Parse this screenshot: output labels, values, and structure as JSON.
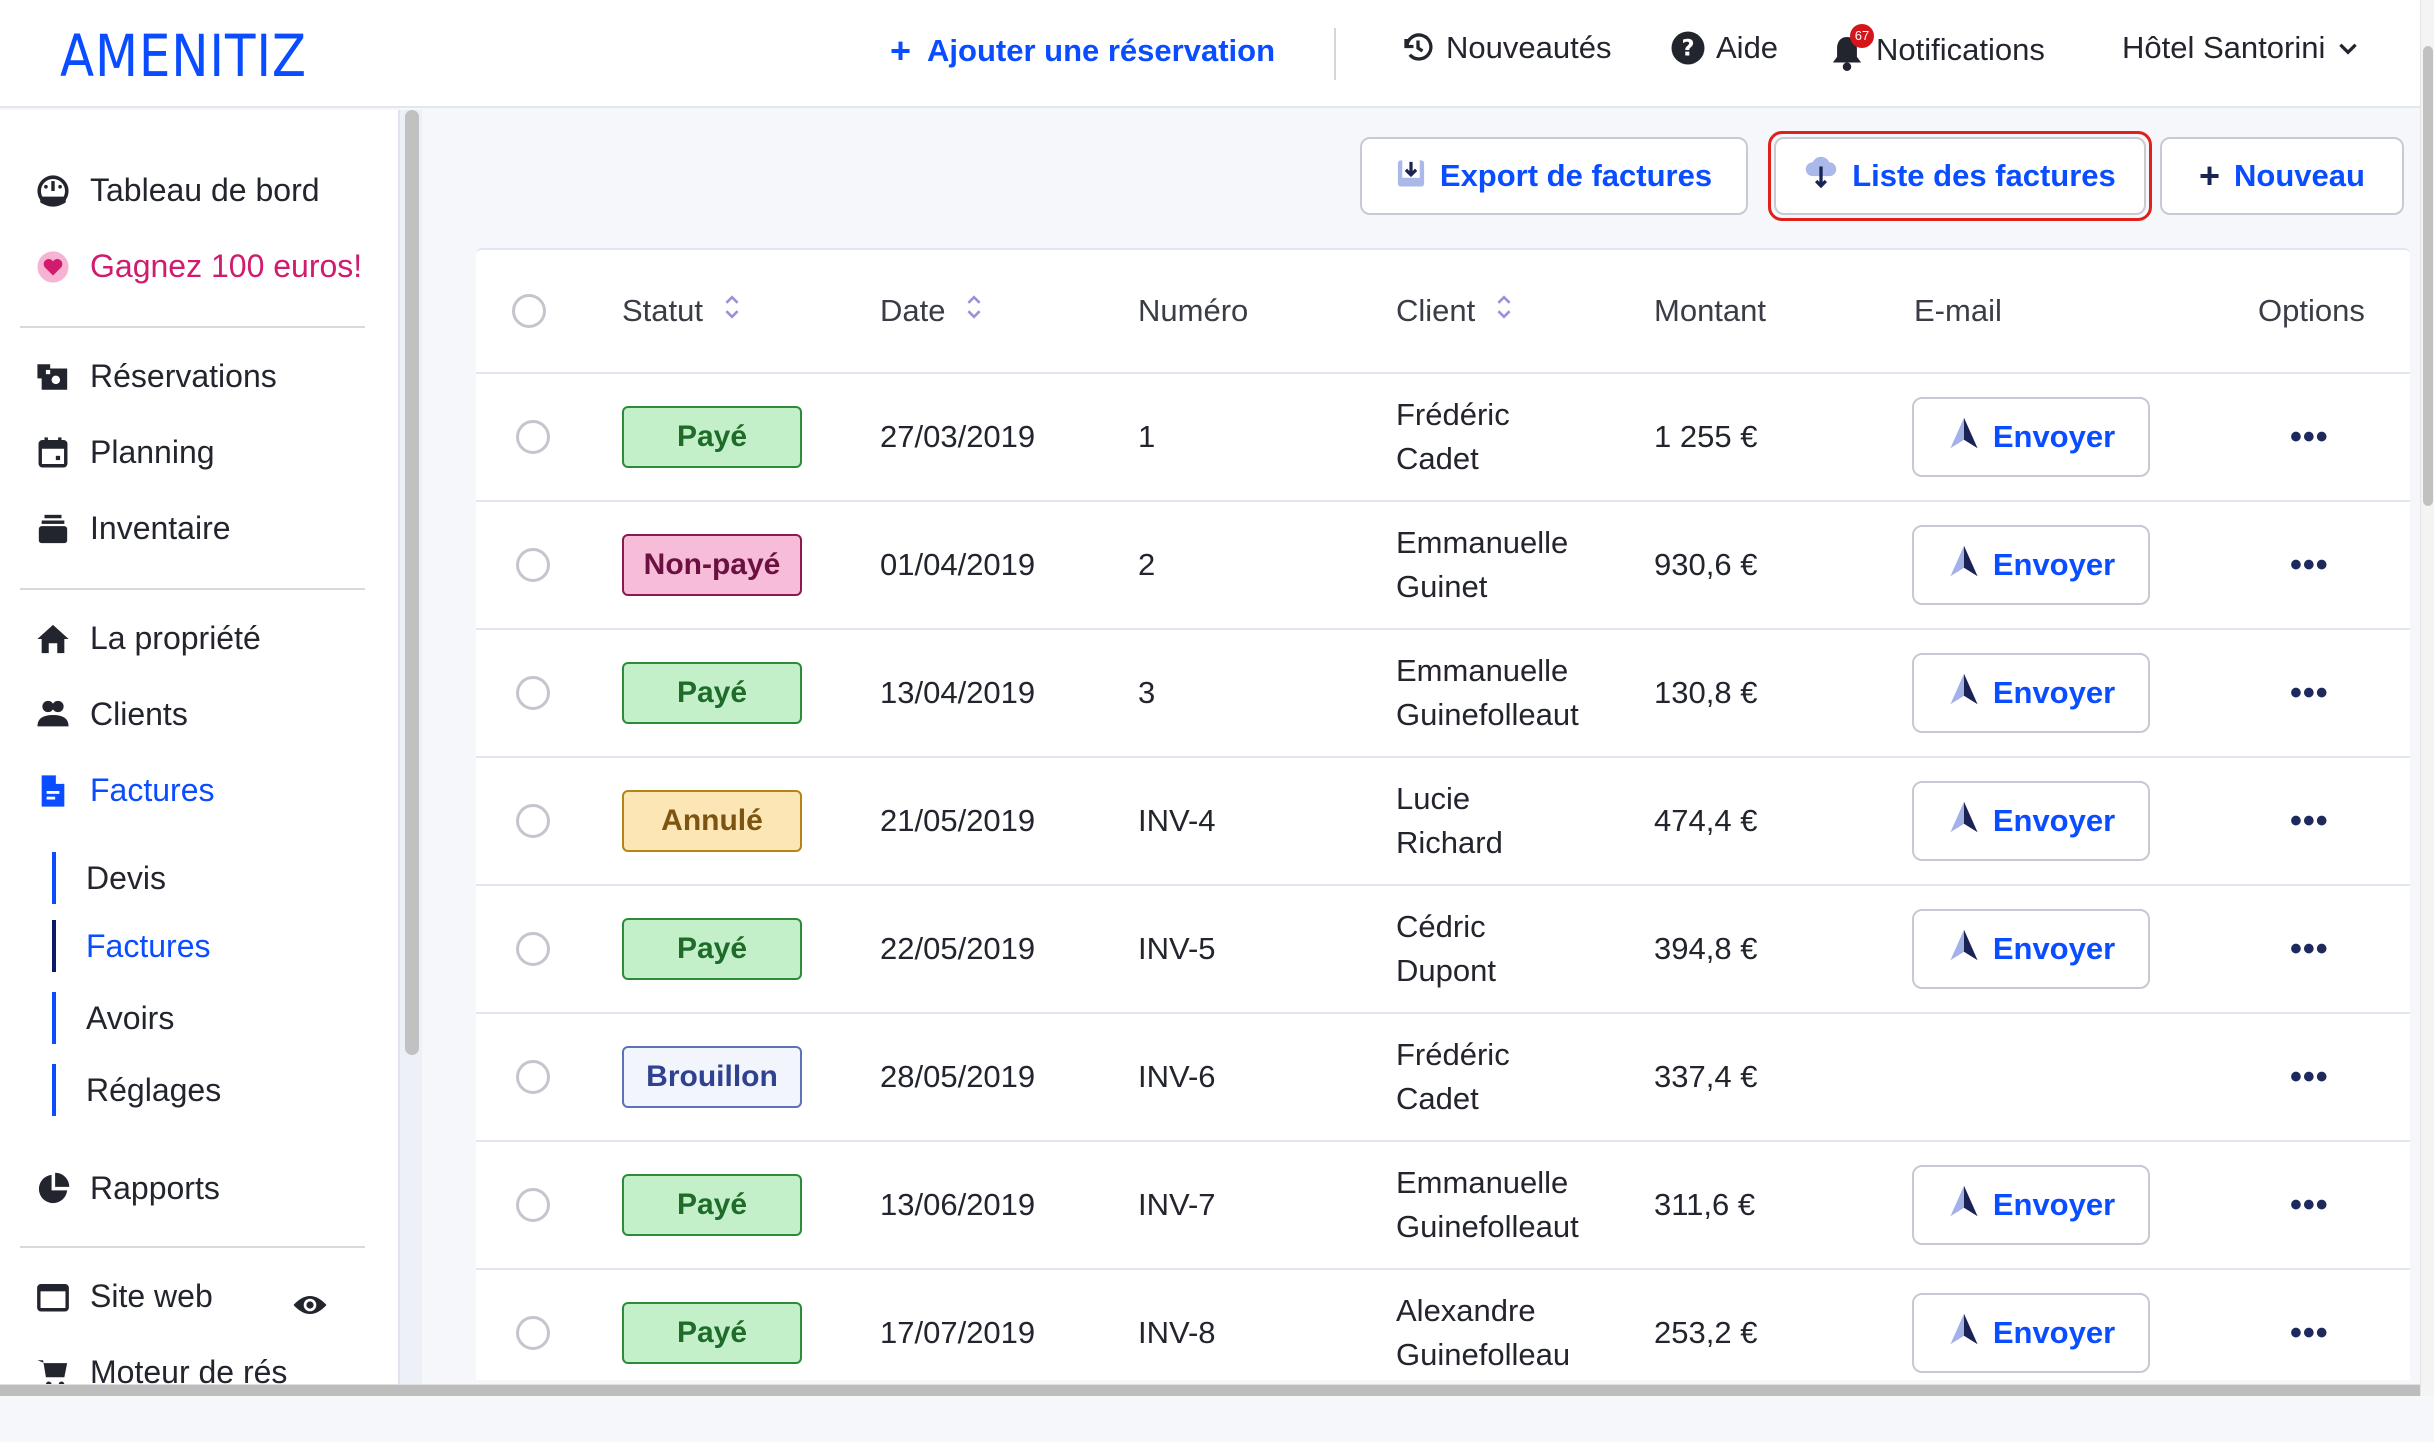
{
  "brand": {
    "logo_text": "AMENITIZ",
    "accent_color": "#0a4cff"
  },
  "header": {
    "add_reservation_label": "Ajouter une réservation",
    "news_label": "Nouveautés",
    "help_label": "Aide",
    "notifications_label": "Notifications",
    "notifications_count": "67",
    "hotel_name": "Hôtel Santorini"
  },
  "sidebar": {
    "items": [
      {
        "label": "Tableau de bord",
        "icon": "dashboard-icon"
      },
      {
        "label": "Gagnez 100 euros!",
        "icon": "heart-icon"
      },
      {
        "label": "Réservations",
        "icon": "reservations-icon"
      },
      {
        "label": "Planning",
        "icon": "calendar-icon"
      },
      {
        "label": "Inventaire",
        "icon": "inventory-icon"
      },
      {
        "label": "La propriété",
        "icon": "home-icon"
      },
      {
        "label": "Clients",
        "icon": "users-icon"
      },
      {
        "label": "Factures",
        "icon": "invoice-icon",
        "active": true
      },
      {
        "label": "Rapports",
        "icon": "pie-chart-icon"
      },
      {
        "label": "Site web",
        "icon": "browser-window-icon"
      },
      {
        "label": "Moteur de rés",
        "icon": "cart-icon"
      }
    ],
    "sub_items": [
      {
        "label": "Devis"
      },
      {
        "label": "Factures",
        "active": true
      },
      {
        "label": "Avoirs"
      },
      {
        "label": "Réglages"
      }
    ]
  },
  "toolbar": {
    "export_label": "Export de factures",
    "list_label": "Liste des factures",
    "new_label": "Nouveau"
  },
  "table": {
    "columns": [
      "Statut",
      "Date",
      "Numéro",
      "Client",
      "Montant",
      "E-mail",
      "Options"
    ],
    "send_label": "Envoyer",
    "options_label": "•••",
    "rows": [
      {
        "status": "Payé",
        "status_kind": "paid",
        "date": "27/03/2019",
        "number": "1",
        "client_first": "Frédéric",
        "client_last": "Cadet",
        "amount": "1 255 €",
        "can_send": true
      },
      {
        "status": "Non-payé",
        "status_kind": "unpaid",
        "date": "01/04/2019",
        "number": "2",
        "client_first": "Emmanuelle",
        "client_last": "Guinet",
        "amount": "930,6 €",
        "can_send": true
      },
      {
        "status": "Payé",
        "status_kind": "paid",
        "date": "13/04/2019",
        "number": "3",
        "client_first": "Emmanuelle",
        "client_last": "Guinefolleaut",
        "amount": "130,8 €",
        "can_send": true
      },
      {
        "status": "Annulé",
        "status_kind": "cancelled",
        "date": "21/05/2019",
        "number": "INV-4",
        "client_first": "Lucie",
        "client_last": "Richard",
        "amount": "474,4 €",
        "can_send": true
      },
      {
        "status": "Payé",
        "status_kind": "paid",
        "date": "22/05/2019",
        "number": "INV-5",
        "client_first": "Cédric",
        "client_last": "Dupont",
        "amount": "394,8 €",
        "can_send": true
      },
      {
        "status": "Brouillon",
        "status_kind": "draft",
        "date": "28/05/2019",
        "number": "INV-6",
        "client_first": "Frédéric",
        "client_last": "Cadet",
        "amount": "337,4 €",
        "can_send": false
      },
      {
        "status": "Payé",
        "status_kind": "paid",
        "date": "13/06/2019",
        "number": "INV-7",
        "client_first": "Emmanuelle",
        "client_last": "Guinefolleaut",
        "amount": "311,6 €",
        "can_send": true
      },
      {
        "status": "Payé",
        "status_kind": "paid",
        "date": "17/07/2019",
        "number": "INV-8",
        "client_first": "Alexandre",
        "client_last": "Guinefolleau",
        "amount": "253,2 €",
        "can_send": true
      }
    ]
  },
  "status_colors": {
    "paid": {
      "bg": "#c4f0c9",
      "border": "#2e8b3a",
      "text": "#1f6b2a"
    },
    "unpaid": {
      "bg": "#f6bcd8",
      "border": "#8a1b4e",
      "text": "#6b1040"
    },
    "cancelled": {
      "bg": "#fde6b6",
      "border": "#b48415",
      "text": "#7a5410"
    },
    "draft": {
      "bg": "#f3f5fd",
      "border": "#5d72b8",
      "text": "#2f4191"
    }
  }
}
